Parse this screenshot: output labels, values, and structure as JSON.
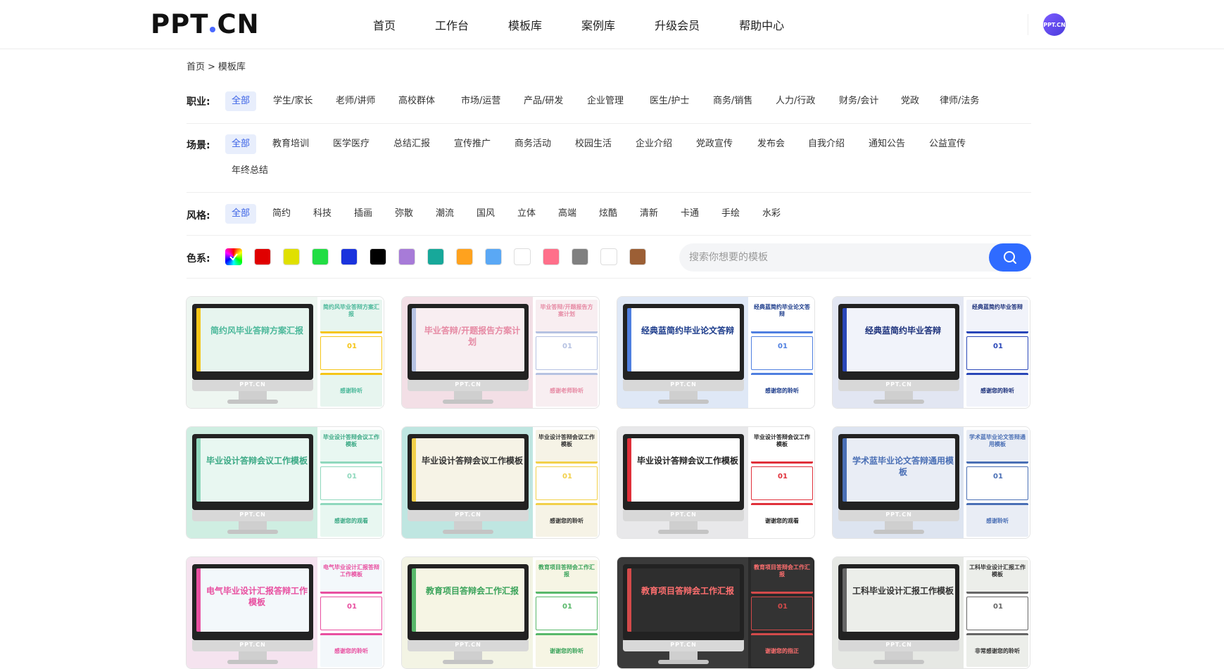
{
  "header": {
    "logo_left": "PPT",
    "logo_right": "CN",
    "nav": [
      "首页",
      "工作台",
      "模板库",
      "案例库",
      "升级会员",
      "帮助中心"
    ],
    "avatar_text": "PPT.CN"
  },
  "breadcrumb": {
    "home": "首页",
    "sep": ">",
    "current": "模板库"
  },
  "filters": {
    "occupation": {
      "label": "职业:",
      "options": [
        "全部",
        "学生/家长",
        "老师/讲师",
        "高校群体",
        "市场/运营",
        "产品/研发",
        "企业管理",
        "医生/护士",
        "商务/销售",
        "人力/行政",
        "财务/会计",
        "党政",
        "律师/法务"
      ]
    },
    "scene": {
      "label": "场景:",
      "options": [
        "全部",
        "教育培训",
        "医学医疗",
        "总结汇报",
        "宣传推广",
        "商务活动",
        "校园生活",
        "企业介绍",
        "党政宣传",
        "发布会",
        "自我介绍",
        "通知公告",
        "公益宣传",
        "年终总结"
      ]
    },
    "style": {
      "label": "风格:",
      "options": [
        "全部",
        "简约",
        "科技",
        "插画",
        "弥散",
        "潮流",
        "国风",
        "立体",
        "高端",
        "炫酷",
        "清新",
        "卡通",
        "手绘",
        "水彩"
      ]
    },
    "color": {
      "label": "色系:",
      "swatches": [
        "rainbow",
        "#e00000",
        "#e0e000",
        "#22dd44",
        "#1a33dd",
        "#000000",
        "#a77bd8",
        "#17a89a",
        "#ffa21e",
        "#5aa8f5",
        "#ffffff",
        "#ff6f8a",
        "#808080",
        "#ffffff",
        "#9c5f35"
      ]
    }
  },
  "search": {
    "placeholder": "搜索你想要的模板"
  },
  "brand_mark": "PPT.CN",
  "cards": [
    {
      "title": "简约风毕业答辩方案汇报",
      "side_title": "简约风毕业答辩方案汇报",
      "num": "01",
      "end": "感谢聆听",
      "bg": "#eef6f1",
      "screen": "#e7f5ef",
      "color": "#4bb89a",
      "accent": "#f5c518"
    },
    {
      "title": "毕业答辩/开题报告方案计划",
      "side_title": "毕业答辩/开题报告方案计划",
      "num": "01",
      "end": "感谢老师聆听",
      "bg": "#f3dfe6",
      "screen": "#f8eef1",
      "color": "#e68aa4",
      "accent": "#b6c2e2"
    },
    {
      "title": "经典蓝简约毕业论文答辩",
      "side_title": "经典蓝简约毕业论文答辩",
      "num": "01",
      "end": "感谢您的聆听",
      "bg": "#dfe8f6",
      "screen": "#ffffff",
      "color": "#1a3a8a",
      "accent": "#4f7fe0"
    },
    {
      "title": "经典蓝简约毕业答辩",
      "side_title": "经典蓝简约毕业答辩",
      "num": "01",
      "end": "感谢您的聆听",
      "bg": "#e2e6f2",
      "screen": "#f1f3fa",
      "color": "#1a2f7a",
      "accent": "#2a47b8"
    },
    {
      "title": "毕业设计答辩会议工作模板",
      "side_title": "毕业设计答辩会议工作模板",
      "num": "01",
      "end": "感谢您的观看",
      "bg": "#cfeee2",
      "screen": "#e8f7f1",
      "color": "#3ba985",
      "accent": "#8fd8bd"
    },
    {
      "title": "毕业设计答辩会议工作模板",
      "side_title": "毕业设计答辩会议工作模板",
      "num": "01",
      "end": "感谢您的聆听",
      "bg": "#bfe6e1",
      "screen": "#f6f3e6",
      "color": "#333333",
      "accent": "#f2d04a"
    },
    {
      "title": "毕业设计答辩会议工作模板",
      "side_title": "毕业设计答辩会议工作模板",
      "num": "01",
      "end": "谢谢您的观看",
      "bg": "#e8e8ea",
      "screen": "#ffffff",
      "color": "#222222",
      "accent": "#e0303a"
    },
    {
      "title": "学术蓝毕业论文答辩通用模板",
      "side_title": "学术蓝毕业论文答辩通用模板",
      "num": "01",
      "end": "感谢聆听",
      "bg": "#dde4f0",
      "screen": "#e9edf5",
      "color": "#ffffff",
      "accent": "#4a6fb5"
    },
    {
      "title": "电气毕业设计汇报答辩工作模板",
      "side_title": "电气毕业设计汇报答辩工作模板",
      "num": "01",
      "end": "感谢您的聆听",
      "bg": "#f5e3ef",
      "screen": "#f3f8fb",
      "color": "#ffffff",
      "accent": "#e84fa0"
    },
    {
      "title": "教育项目答辩会工作汇报",
      "side_title": "教育项目答辩会工作汇报",
      "num": "01",
      "end": "谢谢您的聆听",
      "bg": "#f3f4e4",
      "screen": "#f6f5e4",
      "color": "#3aa35a",
      "accent": "#58b86a"
    },
    {
      "title": "教育项目答辩会工作汇报",
      "side_title": "教育项目答辩会工作汇报",
      "num": "01",
      "end": "谢谢您的指正",
      "bg": "#3a3a3a",
      "screen": "#2e2e2e",
      "color": "#ff6f6f",
      "accent": "#d44a4a"
    },
    {
      "title": "工科毕业设计汇报工作模板",
      "side_title": "工科毕业设计汇报工作模板",
      "num": "01",
      "end": "非常感谢您的聆听",
      "bg": "#e6e8e4",
      "screen": "#eceeea",
      "color": "#333333",
      "accent": "#666666"
    }
  ]
}
